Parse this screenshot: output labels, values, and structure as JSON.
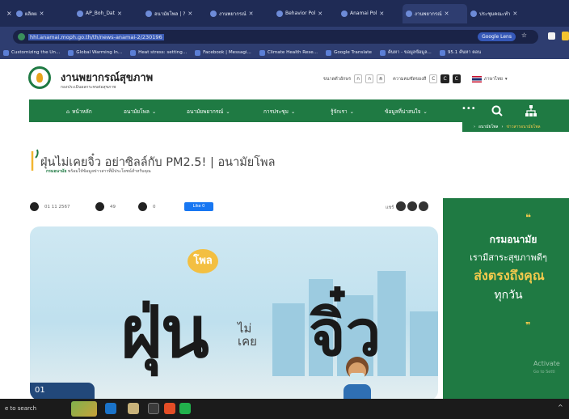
{
  "browser": {
    "tabs": [
      {
        "title": "ผลิตผ"
      },
      {
        "title": "AP_Boh_Dat"
      },
      {
        "title": "อนามัยโพล | ?"
      },
      {
        "title": "งานพยากรณ์"
      },
      {
        "title": "Behavior Pol"
      },
      {
        "title": "Anamai Pol"
      },
      {
        "title": "งานพยากรณ์",
        "active": true
      },
      {
        "title": "ประชุมคณะทำ"
      }
    ],
    "url": "hhl.anamai.moph.go.th/th/news-anamai-2/230196",
    "lens_label": "Google Lens",
    "bookmarks": [
      "Customizing the Un...",
      "Global Warming In...",
      "Heat stress: setting...",
      "Facebook | Messagi...",
      "Climate Health Rese...",
      "Google Translate",
      "ค้นหา - ขอมูลข้อมูล...",
      "95.1 ค้นหา ตอน"
    ]
  },
  "site": {
    "title": "งานพยากรณ์สุขภาพ",
    "subtitle": "กองประเมินผลกระทบต่อสุขภาพ",
    "tools": {
      "text_size_label": "ขนาดตัวอักษร",
      "sizes": [
        "ก",
        "ก",
        "ก"
      ],
      "contrast_label": "ความคมชัดของสี",
      "contrast": [
        "C",
        "C",
        "C"
      ],
      "language": "ภาษาไทย"
    },
    "nav": {
      "home": "หน้าหลัก",
      "item1": "อนามัยโพล",
      "item2": "อนามัยพยากรณ์",
      "item3": "การประชุม",
      "item4": "รู้จักเรา",
      "item5": "ข้อมูลที่น่าสนใจ",
      "more": "•••"
    },
    "breadcrumb": [
      "อนามัยโพล",
      "ข่าวสารอนามัยโพล"
    ]
  },
  "article": {
    "title_glyph": "ฝุ่",
    "title": "นไม่เคยจิ๋ว อย่าซิลล์กับ PM2.5! | อนามัยโพล",
    "sub_brand": "กรมอนามัย",
    "sub_text": "พร้อมให้ข้อมูลข่าวสารที่มีประโยชน์สำหรับคุณ",
    "date": "01 11 2567",
    "views": "49",
    "shares": "0",
    "like_label": "Like 0",
    "share_label": "แชร์"
  },
  "hero": {
    "badge": "โพล",
    "big_text_1": "ฝุ่น",
    "small_text": "ไม่\nเคย",
    "big_text_2": "จิ๋ว",
    "number": "01"
  },
  "promo": {
    "quote_open": "❝",
    "title": "กรมอนามัย",
    "line1": "เรามีสาระสุขภาพดีๆ",
    "line2": "ส่งตรงถึงคุณ",
    "line3": "ทุกวัน",
    "quote_close": "❞"
  },
  "windows": {
    "activate": "Activate",
    "activate_sub": "Go to Setti",
    "taskbar_search": "e to search"
  }
}
